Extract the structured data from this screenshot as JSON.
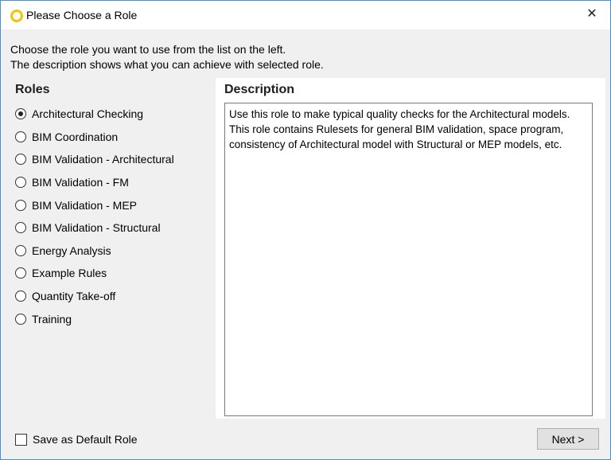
{
  "window": {
    "title": "Please Choose a Role",
    "close_glyph": "✕"
  },
  "intro": {
    "line1": "Choose the role you want to use from the list on the left.",
    "line2": "The description shows what you can achieve with selected role."
  },
  "roles": {
    "title": "Roles",
    "selected_index": 0,
    "items": [
      {
        "label": "Architectural Checking",
        "checked": true
      },
      {
        "label": "BIM Coordination",
        "checked": false
      },
      {
        "label": "BIM Validation - Architectural",
        "checked": false
      },
      {
        "label": "BIM Validation - FM",
        "checked": false
      },
      {
        "label": "BIM Validation - MEP",
        "checked": false
      },
      {
        "label": "BIM Validation - Structural",
        "checked": false
      },
      {
        "label": "Energy Analysis",
        "checked": false
      },
      {
        "label": "Example Rules",
        "checked": false
      },
      {
        "label": "Quantity Take-off",
        "checked": false
      },
      {
        "label": "Training",
        "checked": false
      }
    ]
  },
  "description": {
    "title": "Description",
    "text": "Use this role to make typical quality checks for the Architectural models. This role contains Rulesets for general BIM validation, space program, consistency of Architectural model with Structural or MEP models, etc."
  },
  "footer": {
    "default_role_label": "Save as Default Role",
    "default_role_checked": false,
    "next_label": "Next >"
  },
  "colors": {
    "window_border": "#4a8fd6",
    "app_icon": "#f5c400",
    "dialog_bg": "#f0f0f0"
  }
}
